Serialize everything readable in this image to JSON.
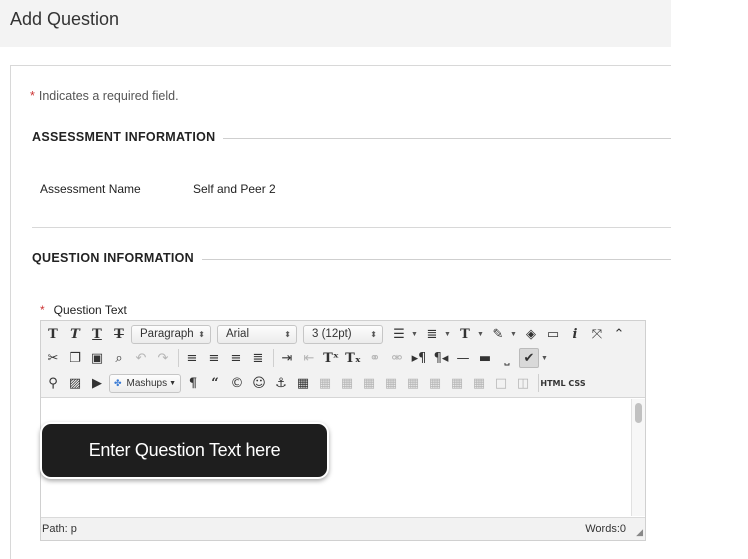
{
  "page": {
    "title": "Add Question"
  },
  "form": {
    "required_star": "*",
    "required_note": "Indicates a required field.",
    "assessment_section": {
      "heading": "ASSESSMENT INFORMATION",
      "name_label": "Assessment Name",
      "name_value": "Self and Peer 2"
    },
    "question_section": {
      "heading": "QUESTION INFORMATION",
      "question_text_label": "Question Text"
    }
  },
  "editor": {
    "paragraph_select": "Paragraph",
    "font_select": "Arial",
    "size_select": "3 (12pt)",
    "mashups_label": "Mashups",
    "html_label": "HTML",
    "css_label": "CSS",
    "path_label": "Path: p",
    "words_label": "Words:0",
    "icons_row1": [
      "bold-icon",
      "italic-icon",
      "underline-icon",
      "strikethrough-icon",
      "unordered-list-icon",
      "ordered-list-icon",
      "text-color-icon",
      "highlight-icon",
      "eraser-icon",
      "preview-icon",
      "info-icon",
      "fullscreen-icon",
      "collapse-toolbar-icon"
    ],
    "icons_row2": [
      "cut-icon",
      "copy-icon",
      "paste-icon",
      "find-icon",
      "undo-icon",
      "redo-icon",
      "align-left-icon",
      "align-center-icon",
      "align-right-icon",
      "justify-icon",
      "indent-icon",
      "outdent-icon",
      "superscript-icon",
      "subscript-icon",
      "link-icon",
      "unlink-icon",
      "ltr-icon",
      "rtl-icon",
      "horizontal-rule-icon",
      "line-icon",
      "nonbreaking-space-icon",
      "spellcheck-icon"
    ],
    "icons_row3": [
      "attach-file-icon",
      "insert-image-icon",
      "insert-media-icon",
      "mashups-icon",
      "paragraph-mark-icon",
      "blockquote-icon",
      "copyright-icon",
      "emoticon-icon",
      "anchor-icon",
      "table-icon",
      "table-row-props-icon",
      "table-cell-props-icon",
      "insert-row-before-icon",
      "insert-row-after-icon",
      "delete-row-icon",
      "insert-col-before-icon",
      "insert-col-after-icon",
      "delete-col-icon",
      "split-cells-icon",
      "merge-cells-icon"
    ]
  },
  "callout": {
    "text": "Enter Question Text here"
  }
}
